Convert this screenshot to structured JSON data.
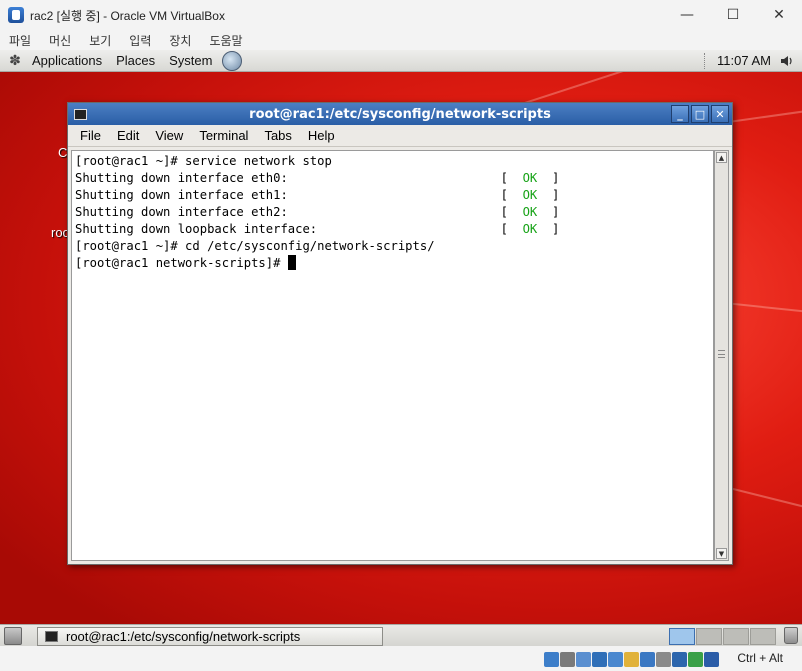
{
  "vbox": {
    "title": "rac2 [실행 중] - Oracle VM VirtualBox",
    "controls": {
      "minimize": "—",
      "maximize": "☐",
      "close": "✕"
    },
    "menu": [
      "파일",
      "머신",
      "보기",
      "입력",
      "장치",
      "도움말"
    ],
    "host_key": "Ctrl + Alt",
    "status_icons": [
      "hard-disk-icon",
      "optical-drive-icon",
      "audio-icon",
      "network-icon",
      "usb-icon",
      "shared-folders-icon",
      "display-icon",
      "recording-icon",
      "vt-x-icon",
      "arrow-down-icon"
    ]
  },
  "gnome": {
    "top_panel": {
      "menus": [
        "Applications",
        "Places",
        "System"
      ],
      "clock": "11:07 AM"
    },
    "desktop_labels": [
      "C",
      "roo"
    ],
    "bottom_panel": {
      "task": "root@rac1:/etc/sysconfig/network-scripts",
      "workspaces": 4,
      "active_workspace": 1
    }
  },
  "terminal": {
    "title": "root@rac1:/etc/sysconfig/network-scripts",
    "menu": [
      "File",
      "Edit",
      "View",
      "Terminal",
      "Tabs",
      "Help"
    ],
    "lines": [
      {
        "text": "[root@rac1 ~]# service network stop"
      },
      {
        "text": "Shutting down interface eth0:                             [  ",
        "ok": "OK",
        "tail": "  ]"
      },
      {
        "text": "Shutting down interface eth1:                             [  ",
        "ok": "OK",
        "tail": "  ]"
      },
      {
        "text": "Shutting down interface eth2:                             [  ",
        "ok": "OK",
        "tail": "  ]"
      },
      {
        "text": "Shutting down loopback interface:                         [  ",
        "ok": "OK",
        "tail": "  ]"
      },
      {
        "text": "[root@rac1 ~]# cd /etc/sysconfig/network-scripts/"
      },
      {
        "text": "[root@rac1 network-scripts]# ",
        "cursor": true
      }
    ]
  },
  "colors": {
    "ok_green": "#18a318",
    "titlebar_blue": "#2a5ea6",
    "desktop_red": "#e01d12"
  }
}
